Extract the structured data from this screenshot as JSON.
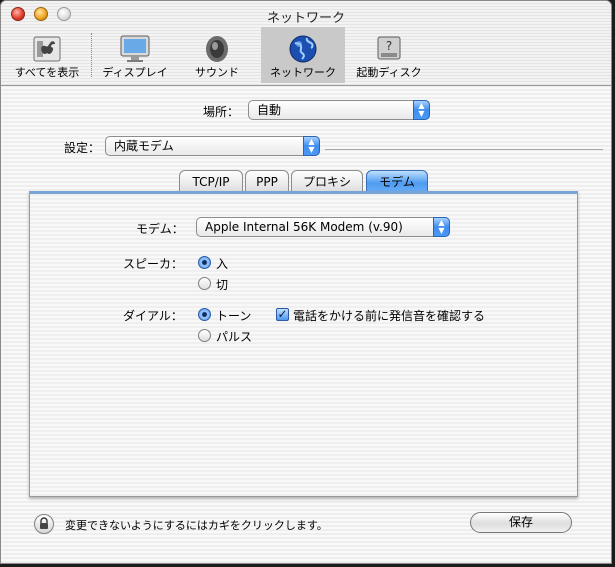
{
  "window": {
    "title": "ネットワーク"
  },
  "toolbar": {
    "items": [
      {
        "label": "すべてを表示",
        "icon": "show-all-icon"
      },
      {
        "label": "ディスプレイ",
        "icon": "display-icon"
      },
      {
        "label": "サウンド",
        "icon": "speaker-icon"
      },
      {
        "label": "ネットワーク",
        "icon": "globe-icon",
        "selected": true
      },
      {
        "label": "起動ディスク",
        "icon": "disk-icon"
      }
    ]
  },
  "location": {
    "label": "場所：",
    "value": "自動"
  },
  "configure": {
    "label": "設定：",
    "value": "内蔵モデム"
  },
  "tabs": [
    {
      "label": "TCP/IP"
    },
    {
      "label": "PPP"
    },
    {
      "label": "プロキシ"
    },
    {
      "label": "モデム",
      "active": true
    }
  ],
  "modem": {
    "modem_label": "モデム：",
    "modem_value": "Apple Internal 56K Modem (v.90)",
    "speaker_label": "スピーカ：",
    "speaker_options": [
      {
        "label": "入",
        "selected": true
      },
      {
        "label": "切",
        "selected": false
      }
    ],
    "dial_label": "ダイアル：",
    "dial_options": [
      {
        "label": "トーン",
        "selected": true
      },
      {
        "label": "パルス",
        "selected": false
      }
    ],
    "wait_checkbox": {
      "label": "電話をかける前に発信音を確認する",
      "checked": true
    }
  },
  "footer": {
    "lock_text": "変更できないようにするにはカギをクリックします。",
    "save_label": "保存"
  },
  "colors": {
    "accent": "#3d8df0",
    "tab_active": "#4e9cf1"
  }
}
